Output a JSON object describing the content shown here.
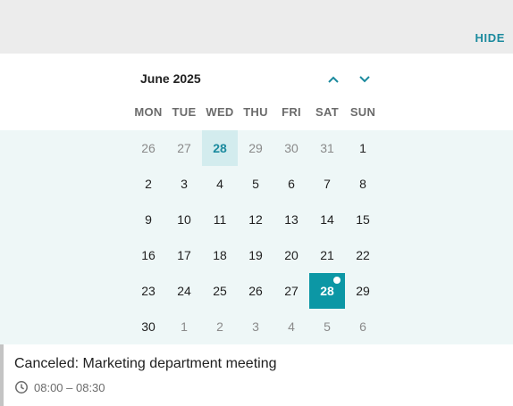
{
  "header": {
    "hide_label": "HIDE"
  },
  "calendar": {
    "month_label": "June 2025",
    "weekdays": [
      "MON",
      "TUE",
      "WED",
      "THU",
      "FRI",
      "SAT",
      "SUN"
    ],
    "weeks": [
      [
        "26",
        "27",
        "28",
        "29",
        "30",
        "31",
        "1"
      ],
      [
        "2",
        "3",
        "4",
        "5",
        "6",
        "7",
        "8"
      ],
      [
        "9",
        "10",
        "11",
        "12",
        "13",
        "14",
        "15"
      ],
      [
        "16",
        "17",
        "18",
        "19",
        "20",
        "21",
        "22"
      ],
      [
        "23",
        "24",
        "25",
        "26",
        "27",
        "28",
        "29"
      ],
      [
        "30",
        "1",
        "2",
        "3",
        "4",
        "5",
        "6"
      ]
    ]
  },
  "event": {
    "title": "Canceled: Marketing department meeting",
    "time": "08:00 – 08:30"
  },
  "colors": {
    "accent": "#0c97a5",
    "accent_text": "#1b8a9e",
    "grid_background": "#eef7f7",
    "highlight_background": "#d3ecee"
  }
}
